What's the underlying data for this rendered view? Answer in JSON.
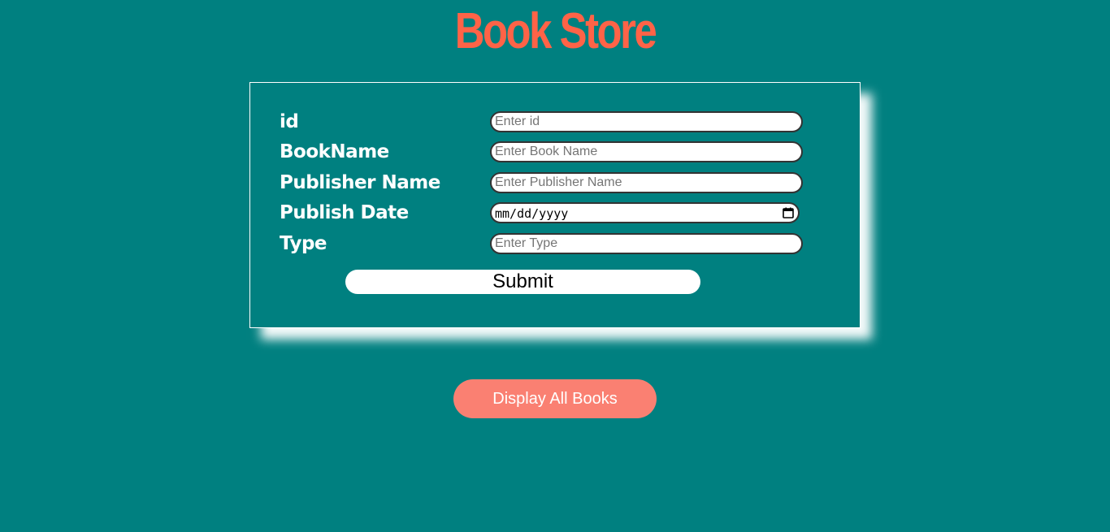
{
  "page": {
    "title": "Book Store",
    "colors": {
      "background": "#008080",
      "title": "#FF6347",
      "display_button": "#FA8072",
      "label": "#FFFFFF"
    }
  },
  "form": {
    "fields": [
      {
        "label": "id",
        "placeholder": "Enter id",
        "value": ""
      },
      {
        "label": "BookName",
        "placeholder": "Enter Book Name",
        "value": ""
      },
      {
        "label": "Publisher Name",
        "placeholder": "Enter Publisher Name",
        "value": ""
      },
      {
        "label": "Publish Date",
        "placeholder": "mm/dd/yyyy",
        "value": ""
      },
      {
        "label": "Type",
        "placeholder": "Enter Type",
        "value": ""
      }
    ],
    "date_icon": "calendar-icon",
    "submit_label": "Submit"
  },
  "actions": {
    "display_all_label": "Display All Books"
  }
}
